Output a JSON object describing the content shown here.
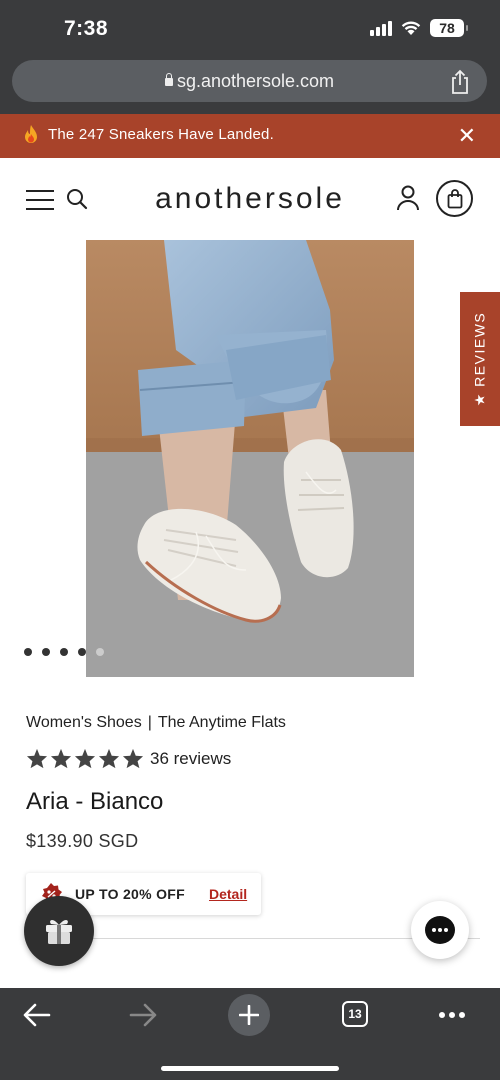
{
  "status_bar": {
    "time": "7:38",
    "battery": "78",
    "icons": [
      "signal-icon",
      "wifi-icon",
      "battery-icon"
    ]
  },
  "browser": {
    "url": "sg.anothersole.com",
    "tab_count": "13",
    "icons": [
      "lock-icon",
      "share-icon",
      "back-arrow-icon",
      "forward-arrow-icon",
      "plus-icon",
      "tabs-icon",
      "more-icon"
    ]
  },
  "banner": {
    "text": "The 247 Sneakers Have Landed.",
    "close_label": "✕",
    "accent_color": "#a8432a"
  },
  "header": {
    "logo": "anothersole",
    "icons": [
      "menu-icon",
      "search-icon",
      "account-icon",
      "cart-icon"
    ]
  },
  "reviews_tab": {
    "label": "★ REVIEWS"
  },
  "carousel": {
    "total": 5,
    "active_index": 3
  },
  "product": {
    "breadcrumb_category": "Women's Shoes",
    "breadcrumb_separator": "|",
    "breadcrumb_collection": "The Anytime Flats",
    "rating_stars": 5,
    "reviews_count": "36 reviews",
    "title": "Aria - Bianco",
    "price": "$139.90 SGD"
  },
  "promo": {
    "text": "UP TO 20% OFF",
    "link": "Detail",
    "link_color": "#b3261e"
  },
  "floating": {
    "icons": [
      "gift-icon",
      "chat-icon"
    ]
  }
}
